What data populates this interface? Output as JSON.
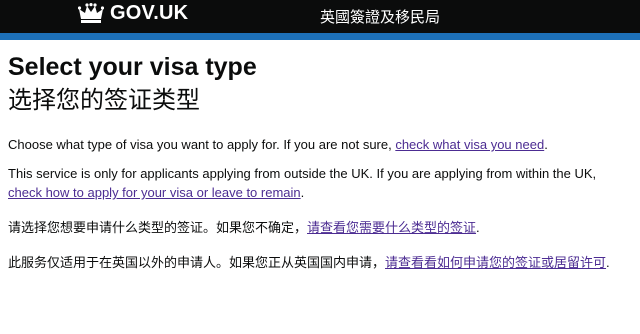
{
  "header": {
    "brand": "GOV.UK",
    "service_name": "英國簽證及移民局"
  },
  "main": {
    "title": "Select your visa type",
    "title_cn": "选择您的签证类型",
    "p1": {
      "text": "Choose what type of visa you want to apply for. If you are not sure, ",
      "link": "check what visa you need",
      "end": "."
    },
    "p2": {
      "text": "This service is only for applicants applying from outside the UK. If you are applying from within the UK, ",
      "link": "check how to apply for your visa or leave to remain",
      "end": "."
    },
    "p3": {
      "text": "请选择您想要申请什么类型的签证。如果您不确定，",
      "link": "请查看您需要什么类型的签证",
      "end": "."
    },
    "p4": {
      "text": "此服务仅适用于在英国以外的申请人。如果您正从英国国内申请，",
      "link": "请查看看如何申请您的签证或居留许可",
      "end": "."
    }
  }
}
